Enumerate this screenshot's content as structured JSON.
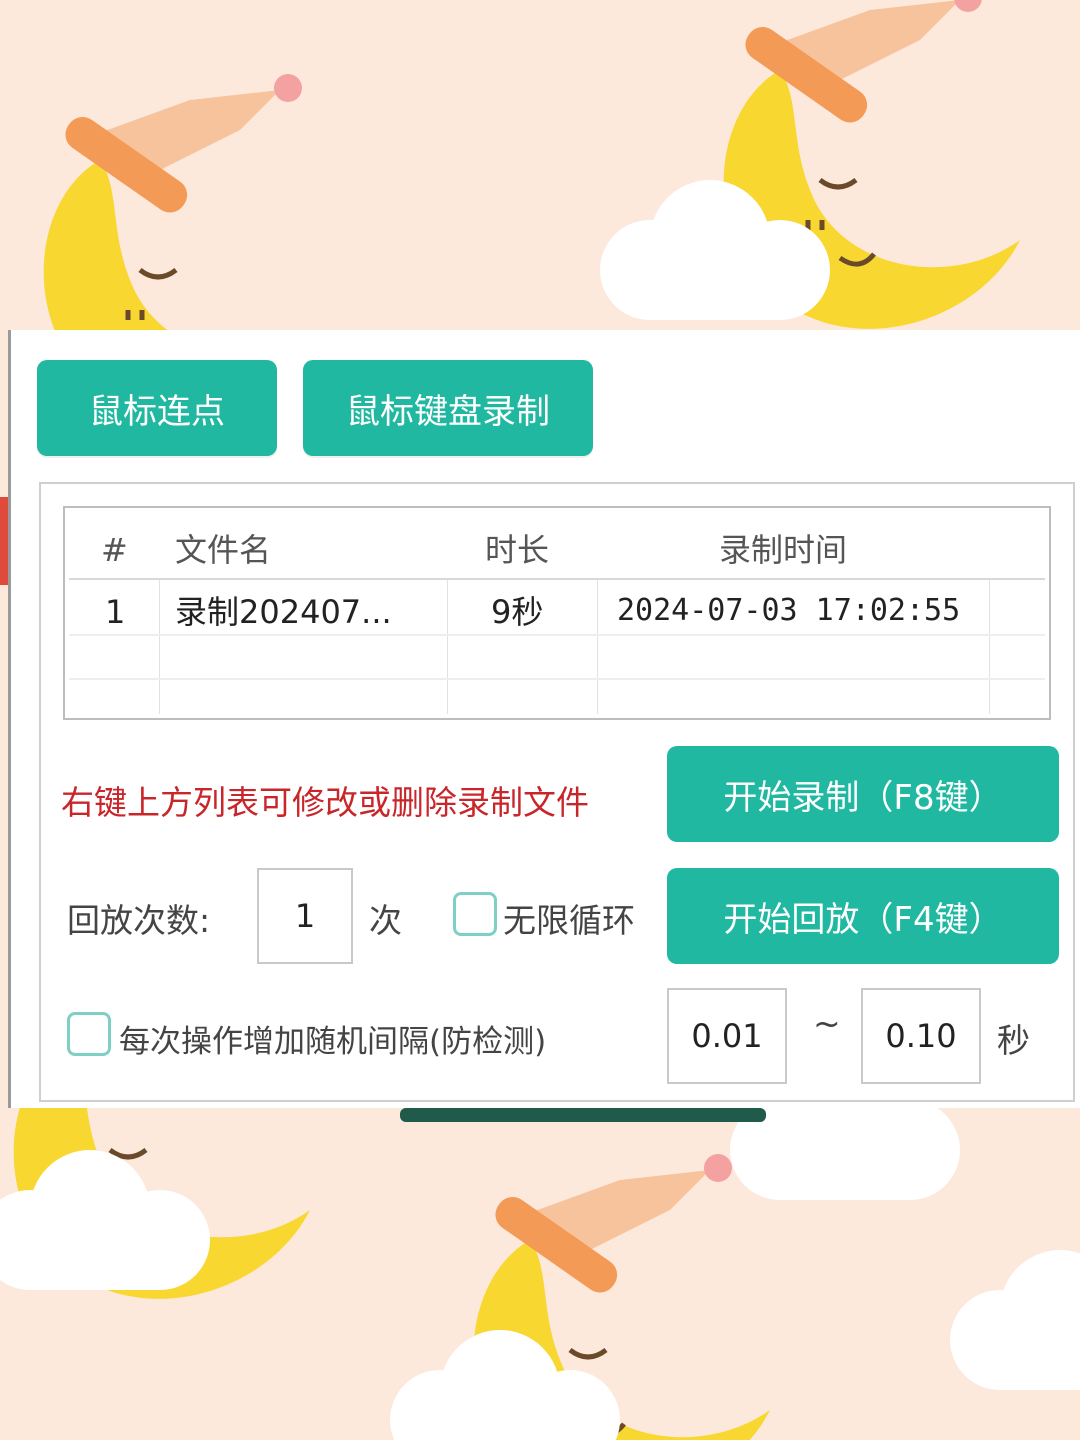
{
  "tabs": [
    {
      "label": "鼠标连点"
    },
    {
      "label": "鼠标键盘录制"
    }
  ],
  "table": {
    "headers": [
      "#",
      "文件名",
      "时长",
      "录制时间"
    ],
    "rows": [
      {
        "index": "1",
        "filename": "录制202407...",
        "duration": "9秒",
        "time": "2024-07-03 17:02:55"
      }
    ]
  },
  "hint": "右键上方列表可修改或删除录制文件",
  "buttons": {
    "start_record": "开始录制（F8键）",
    "start_playback": "开始回放（F4键）"
  },
  "playback": {
    "count_label": "回放次数:",
    "count_value": "1",
    "count_unit": "次",
    "infinite_label": "无限循环",
    "infinite_checked": false
  },
  "random_interval": {
    "label": "每次操作增加随机间隔(防检测)",
    "checked": false,
    "min": "0.01",
    "separator": "~",
    "max": "0.10",
    "unit": "秒"
  },
  "colors": {
    "accent": "#20b8a0",
    "hint": "#c8262a",
    "background": "#fde8dc"
  },
  "icons": [
    "moon-sleeping-icon",
    "cloud-icon"
  ]
}
